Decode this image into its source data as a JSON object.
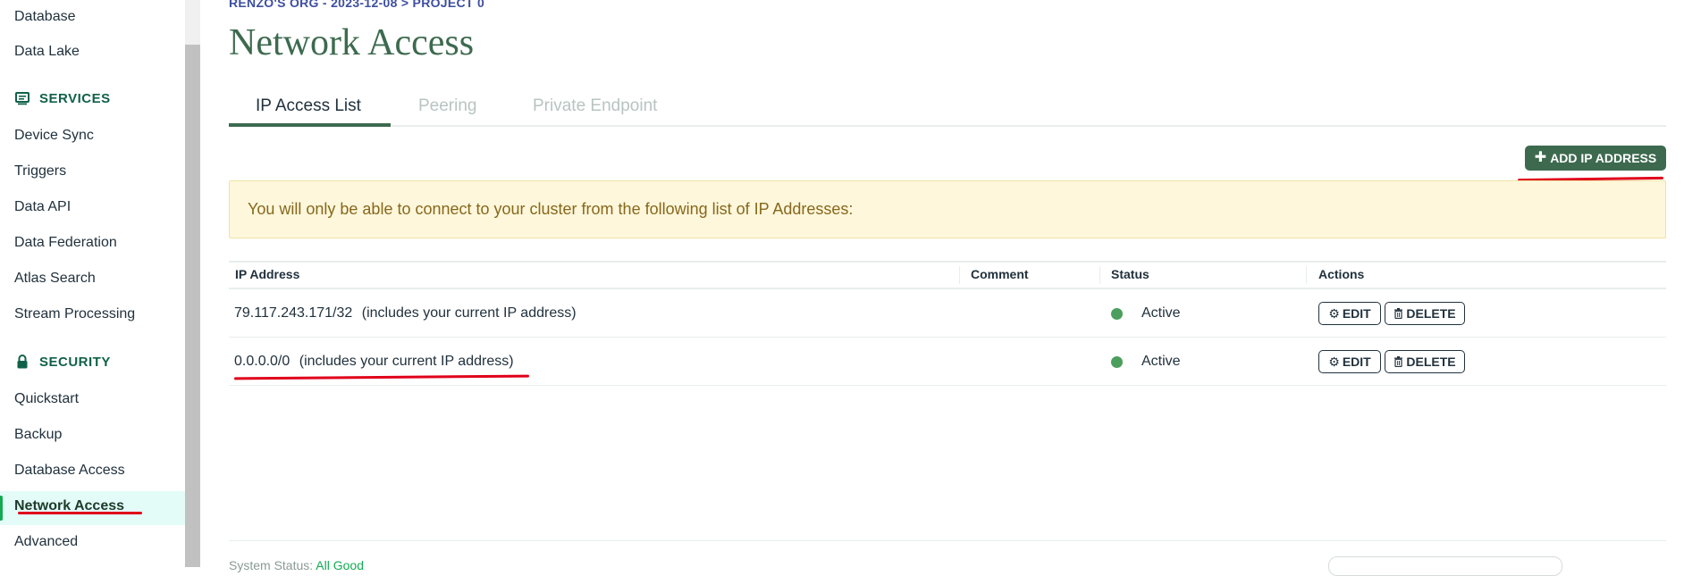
{
  "sidebar": {
    "items_top": [
      "Database",
      "Data Lake"
    ],
    "services_label": "SERVICES",
    "services": [
      "Device Sync",
      "Triggers",
      "Data API",
      "Data Federation",
      "Atlas Search",
      "Stream Processing"
    ],
    "security_label": "SECURITY",
    "security": [
      "Quickstart",
      "Backup",
      "Database Access",
      "Network Access",
      "Advanced"
    ],
    "active_item": "Network Access"
  },
  "header": {
    "breadcrumb": "RENZO'S ORG - 2023-12-08 > PROJECT 0",
    "title": "Network Access"
  },
  "tabs": [
    {
      "label": "IP Access List",
      "selected": true
    },
    {
      "label": "Peering",
      "selected": false
    },
    {
      "label": "Private Endpoint",
      "selected": false
    }
  ],
  "add_button_label": "ADD IP ADDRESS",
  "banner_text": "You will only be able to connect to your cluster from the following list of IP Addresses:",
  "table": {
    "columns": [
      "IP Address",
      "Comment",
      "Status",
      "Actions"
    ],
    "rows": [
      {
        "ip": "79.117.243.171/32",
        "note": "(includes your current IP address)",
        "comment": "",
        "status": "Active"
      },
      {
        "ip": "0.0.0.0/0",
        "note": "(includes your current IP address)",
        "comment": "",
        "status": "Active"
      }
    ],
    "edit_label": "EDIT",
    "delete_label": "DELETE"
  },
  "footer": {
    "status_prefix": "System Status:",
    "status_value": "All Good"
  },
  "colors": {
    "brand_green": "#3d6a4f",
    "status_active": "#4c9e5d",
    "banner_bg": "#fef7db",
    "annotation_red": "#e0001a"
  }
}
